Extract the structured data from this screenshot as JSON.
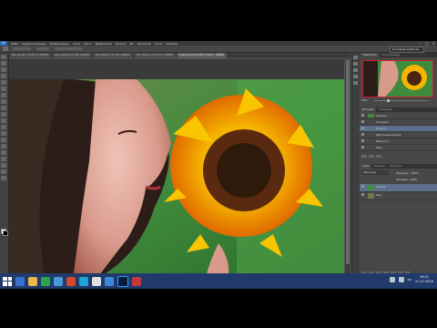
{
  "menubar": {
    "logo": "Ps",
    "items": [
      "Файл",
      "Редактирование",
      "Изображение",
      "Слои",
      "Текст",
      "Выделение",
      "Фильтр",
      "3D",
      "Просмотр",
      "Окно",
      "Справка"
    ],
    "window_controls": [
      "–",
      "□",
      "✕"
    ]
  },
  "optionsbar": {
    "workspace": "Основная рабочая среда"
  },
  "tabs": [
    {
      "label": "Без имени-1 @ 66,7% (RGB/8)",
      "active": false
    },
    {
      "label": "Без имени-2 @ 50% (RGB/8)",
      "active": false
    },
    {
      "label": "Без имени-3 @ 25% (RGB/8)",
      "active": false
    },
    {
      "label": "Без имени-4 @ 33,3% (RGB/8)",
      "active": false
    },
    {
      "label": "Подсолнух-2 @ 50% (Слой 1, RGB/8)",
      "active": true
    }
  ],
  "statusbar": {
    "zoom": "50%",
    "doc": "Док: 5,93M/35,9M"
  },
  "panel": {
    "navigator_tabs": [
      "Навигатор",
      "Гистограмма"
    ],
    "zoom_value": "50%",
    "layers_tabs": [
      "Слои",
      "Каналы",
      "Контуры"
    ],
    "history_tabs": [
      "История",
      "Операции"
    ],
    "blend_mode": "Обычные",
    "opacity_label": "Непрозр.: 100%",
    "fill_label": "Заливка: 100%",
    "layers_top": [
      {
        "name": "Снимок",
        "selected": false
      },
      {
        "name": "Открыть",
        "selected": false
      },
      {
        "name": "Слой 1",
        "selected": true
      },
      {
        "name": "Масляная краска",
        "selected": false
      },
      {
        "name": "Резкость",
        "selected": false
      },
      {
        "name": "Фон",
        "selected": false
      }
    ],
    "layers_bottom": [
      {
        "name": "Слой 1",
        "selected": true
      },
      {
        "name": "Фон",
        "selected": false
      }
    ]
  },
  "tray": {
    "lang": "RU",
    "time": "16:01",
    "date": "21.07.2016"
  },
  "colors": {
    "accent": "#5d6f8a",
    "taskbar": "#1f3a6b"
  }
}
